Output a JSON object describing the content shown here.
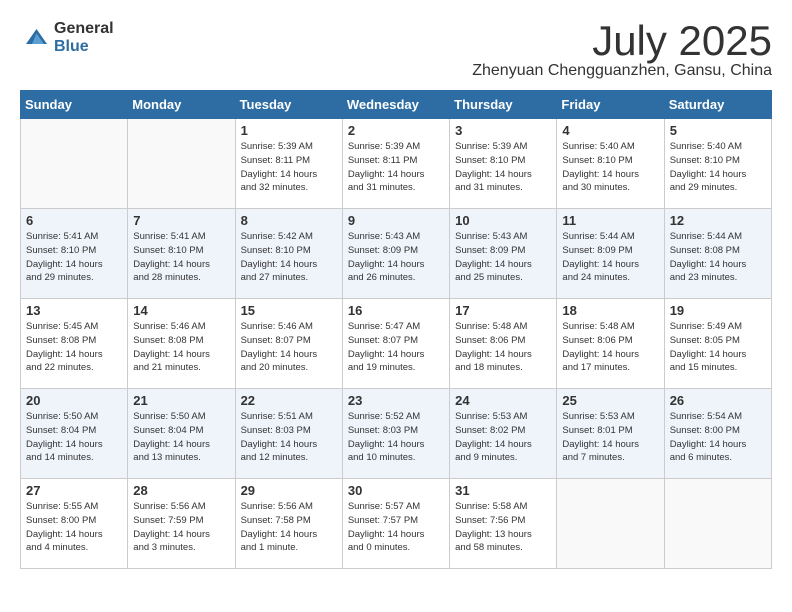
{
  "logo": {
    "general": "General",
    "blue": "Blue"
  },
  "title": "July 2025",
  "subtitle": "Zhenyuan Chengguanzhen, Gansu, China",
  "days_of_week": [
    "Sunday",
    "Monday",
    "Tuesday",
    "Wednesday",
    "Thursday",
    "Friday",
    "Saturday"
  ],
  "weeks": [
    [
      {
        "day": "",
        "info": ""
      },
      {
        "day": "",
        "info": ""
      },
      {
        "day": "1",
        "info": "Sunrise: 5:39 AM\nSunset: 8:11 PM\nDaylight: 14 hours\nand 32 minutes."
      },
      {
        "day": "2",
        "info": "Sunrise: 5:39 AM\nSunset: 8:11 PM\nDaylight: 14 hours\nand 31 minutes."
      },
      {
        "day": "3",
        "info": "Sunrise: 5:39 AM\nSunset: 8:10 PM\nDaylight: 14 hours\nand 31 minutes."
      },
      {
        "day": "4",
        "info": "Sunrise: 5:40 AM\nSunset: 8:10 PM\nDaylight: 14 hours\nand 30 minutes."
      },
      {
        "day": "5",
        "info": "Sunrise: 5:40 AM\nSunset: 8:10 PM\nDaylight: 14 hours\nand 29 minutes."
      }
    ],
    [
      {
        "day": "6",
        "info": "Sunrise: 5:41 AM\nSunset: 8:10 PM\nDaylight: 14 hours\nand 29 minutes."
      },
      {
        "day": "7",
        "info": "Sunrise: 5:41 AM\nSunset: 8:10 PM\nDaylight: 14 hours\nand 28 minutes."
      },
      {
        "day": "8",
        "info": "Sunrise: 5:42 AM\nSunset: 8:10 PM\nDaylight: 14 hours\nand 27 minutes."
      },
      {
        "day": "9",
        "info": "Sunrise: 5:43 AM\nSunset: 8:09 PM\nDaylight: 14 hours\nand 26 minutes."
      },
      {
        "day": "10",
        "info": "Sunrise: 5:43 AM\nSunset: 8:09 PM\nDaylight: 14 hours\nand 25 minutes."
      },
      {
        "day": "11",
        "info": "Sunrise: 5:44 AM\nSunset: 8:09 PM\nDaylight: 14 hours\nand 24 minutes."
      },
      {
        "day": "12",
        "info": "Sunrise: 5:44 AM\nSunset: 8:08 PM\nDaylight: 14 hours\nand 23 minutes."
      }
    ],
    [
      {
        "day": "13",
        "info": "Sunrise: 5:45 AM\nSunset: 8:08 PM\nDaylight: 14 hours\nand 22 minutes."
      },
      {
        "day": "14",
        "info": "Sunrise: 5:46 AM\nSunset: 8:08 PM\nDaylight: 14 hours\nand 21 minutes."
      },
      {
        "day": "15",
        "info": "Sunrise: 5:46 AM\nSunset: 8:07 PM\nDaylight: 14 hours\nand 20 minutes."
      },
      {
        "day": "16",
        "info": "Sunrise: 5:47 AM\nSunset: 8:07 PM\nDaylight: 14 hours\nand 19 minutes."
      },
      {
        "day": "17",
        "info": "Sunrise: 5:48 AM\nSunset: 8:06 PM\nDaylight: 14 hours\nand 18 minutes."
      },
      {
        "day": "18",
        "info": "Sunrise: 5:48 AM\nSunset: 8:06 PM\nDaylight: 14 hours\nand 17 minutes."
      },
      {
        "day": "19",
        "info": "Sunrise: 5:49 AM\nSunset: 8:05 PM\nDaylight: 14 hours\nand 15 minutes."
      }
    ],
    [
      {
        "day": "20",
        "info": "Sunrise: 5:50 AM\nSunset: 8:04 PM\nDaylight: 14 hours\nand 14 minutes."
      },
      {
        "day": "21",
        "info": "Sunrise: 5:50 AM\nSunset: 8:04 PM\nDaylight: 14 hours\nand 13 minutes."
      },
      {
        "day": "22",
        "info": "Sunrise: 5:51 AM\nSunset: 8:03 PM\nDaylight: 14 hours\nand 12 minutes."
      },
      {
        "day": "23",
        "info": "Sunrise: 5:52 AM\nSunset: 8:03 PM\nDaylight: 14 hours\nand 10 minutes."
      },
      {
        "day": "24",
        "info": "Sunrise: 5:53 AM\nSunset: 8:02 PM\nDaylight: 14 hours\nand 9 minutes."
      },
      {
        "day": "25",
        "info": "Sunrise: 5:53 AM\nSunset: 8:01 PM\nDaylight: 14 hours\nand 7 minutes."
      },
      {
        "day": "26",
        "info": "Sunrise: 5:54 AM\nSunset: 8:00 PM\nDaylight: 14 hours\nand 6 minutes."
      }
    ],
    [
      {
        "day": "27",
        "info": "Sunrise: 5:55 AM\nSunset: 8:00 PM\nDaylight: 14 hours\nand 4 minutes."
      },
      {
        "day": "28",
        "info": "Sunrise: 5:56 AM\nSunset: 7:59 PM\nDaylight: 14 hours\nand 3 minutes."
      },
      {
        "day": "29",
        "info": "Sunrise: 5:56 AM\nSunset: 7:58 PM\nDaylight: 14 hours\nand 1 minute."
      },
      {
        "day": "30",
        "info": "Sunrise: 5:57 AM\nSunset: 7:57 PM\nDaylight: 14 hours\nand 0 minutes."
      },
      {
        "day": "31",
        "info": "Sunrise: 5:58 AM\nSunset: 7:56 PM\nDaylight: 13 hours\nand 58 minutes."
      },
      {
        "day": "",
        "info": ""
      },
      {
        "day": "",
        "info": ""
      }
    ]
  ]
}
